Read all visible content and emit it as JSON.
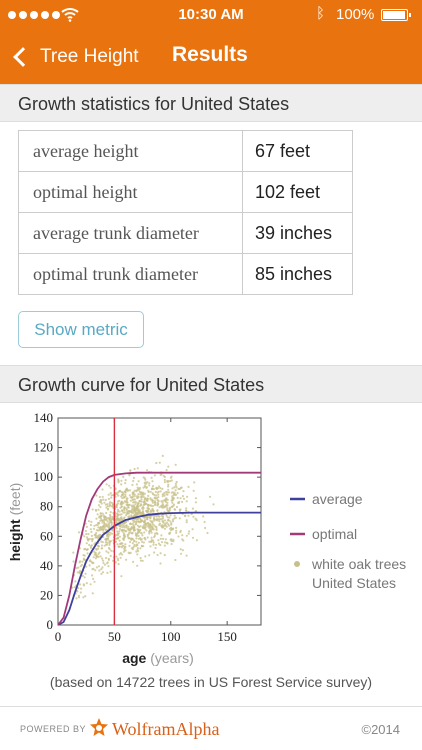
{
  "status_bar": {
    "time": "10:30 AM",
    "battery": "100%"
  },
  "nav": {
    "back_label": "Tree Height",
    "title": "Results"
  },
  "stats_section": {
    "title": "Growth statistics for United States",
    "rows": [
      {
        "label": "average height",
        "value": "67 feet"
      },
      {
        "label": "optimal height",
        "value": "102 feet"
      },
      {
        "label": "average trunk diameter",
        "value": "39 inches"
      },
      {
        "label": "optimal trunk diameter",
        "value": "85 inches"
      }
    ],
    "metric_button": "Show metric"
  },
  "curve_section": {
    "title": "Growth curve for United States",
    "note": "(based on 14722 trees in US Forest Service survey)"
  },
  "chart_data": {
    "type": "scatter",
    "xlabel": "age",
    "xlabel_unit": "(years)",
    "ylabel": "height",
    "ylabel_unit": "(feet)",
    "xlim": [
      0,
      180
    ],
    "ylim": [
      0,
      140
    ],
    "x_ticks": [
      0,
      50,
      100,
      150
    ],
    "y_ticks": [
      0,
      20,
      40,
      60,
      80,
      100,
      120,
      140
    ],
    "vline": 50,
    "series": [
      {
        "name": "average",
        "kind": "line",
        "color": "#3f3f9e",
        "asymptote": 76,
        "x": [
          0,
          5,
          10,
          15,
          20,
          25,
          30,
          35,
          40,
          45,
          50,
          60,
          70,
          80,
          90,
          100,
          120,
          140,
          160,
          180
        ],
        "values": [
          0,
          2,
          10,
          22,
          33,
          43,
          50,
          56,
          61,
          64,
          67,
          71,
          73,
          74.5,
          75.3,
          75.7,
          76,
          76,
          76,
          76
        ]
      },
      {
        "name": "optimal",
        "kind": "line",
        "color": "#a23a7a",
        "asymptote": 103,
        "x": [
          0,
          5,
          10,
          15,
          20,
          25,
          30,
          35,
          40,
          45,
          50,
          60,
          70,
          80,
          90,
          100,
          120,
          140,
          160,
          180
        ],
        "values": [
          0,
          5,
          20,
          40,
          58,
          74,
          85,
          92,
          97,
          100,
          101.5,
          102.5,
          103,
          103,
          103,
          103,
          103,
          103,
          103,
          103
        ]
      },
      {
        "name": "white oak trees United States",
        "kind": "scatter",
        "color": "#c8c08a",
        "x_range": [
          12,
          160
        ],
        "y_range": [
          18,
          128
        ],
        "center": [
          65,
          75
        ]
      }
    ],
    "legend": {
      "position": "right",
      "labels": [
        "average",
        "optimal",
        "white oak trees",
        "United States"
      ]
    }
  },
  "colors": {
    "accent": "#e8730f",
    "link": "#5aa9c4"
  },
  "icons": [
    "back-chevron-icon",
    "wifi-icon",
    "bluetooth-icon",
    "battery-icon",
    "wolfram-spikey-icon"
  ],
  "footer": {
    "powered": "POWERED BY",
    "brand": "WolframAlpha",
    "copyright": "©2014"
  }
}
